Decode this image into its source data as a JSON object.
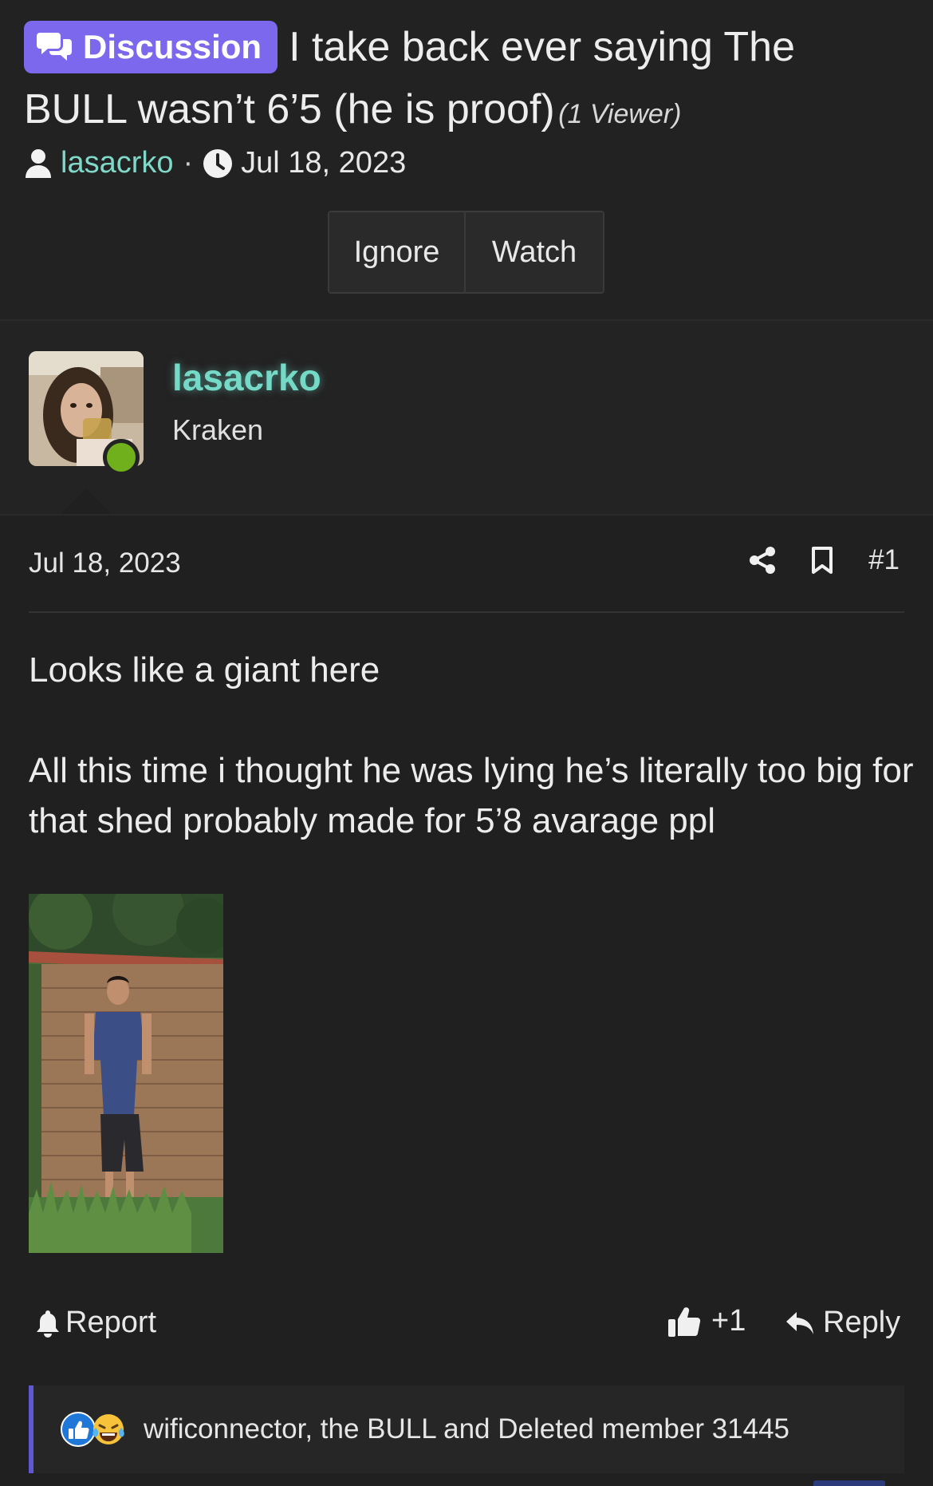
{
  "thread": {
    "prefix": "Discussion",
    "title_line1": "I take back ever saying The",
    "title_line2": "BULL wasn’t 6’5 (he is proof)",
    "viewers": "(1 Viewer)",
    "author": "lasacrko",
    "separator": "·",
    "date": "Jul 18, 2023",
    "actions": {
      "ignore": "Ignore",
      "watch": "Watch"
    }
  },
  "post": {
    "username": "lasacrko",
    "user_title": "Kraken",
    "date": "Jul 18, 2023",
    "post_number": "#1",
    "paragraph1": "Looks like a giant here",
    "paragraph2": "All this time i thought he was lying he’s literally too big for that shed probably made for 5’8 avarage ppl",
    "report_label": "Report",
    "like_count": "+1",
    "reply_label": "Reply",
    "reactions_text": "wificonnector, the BULL and Deleted member 31445"
  },
  "colors": {
    "background": "#202020",
    "badge": "#7c68ec",
    "username": "#74d9c6",
    "online": "#6fb01c",
    "reaction_bar": "#5f58d2"
  }
}
